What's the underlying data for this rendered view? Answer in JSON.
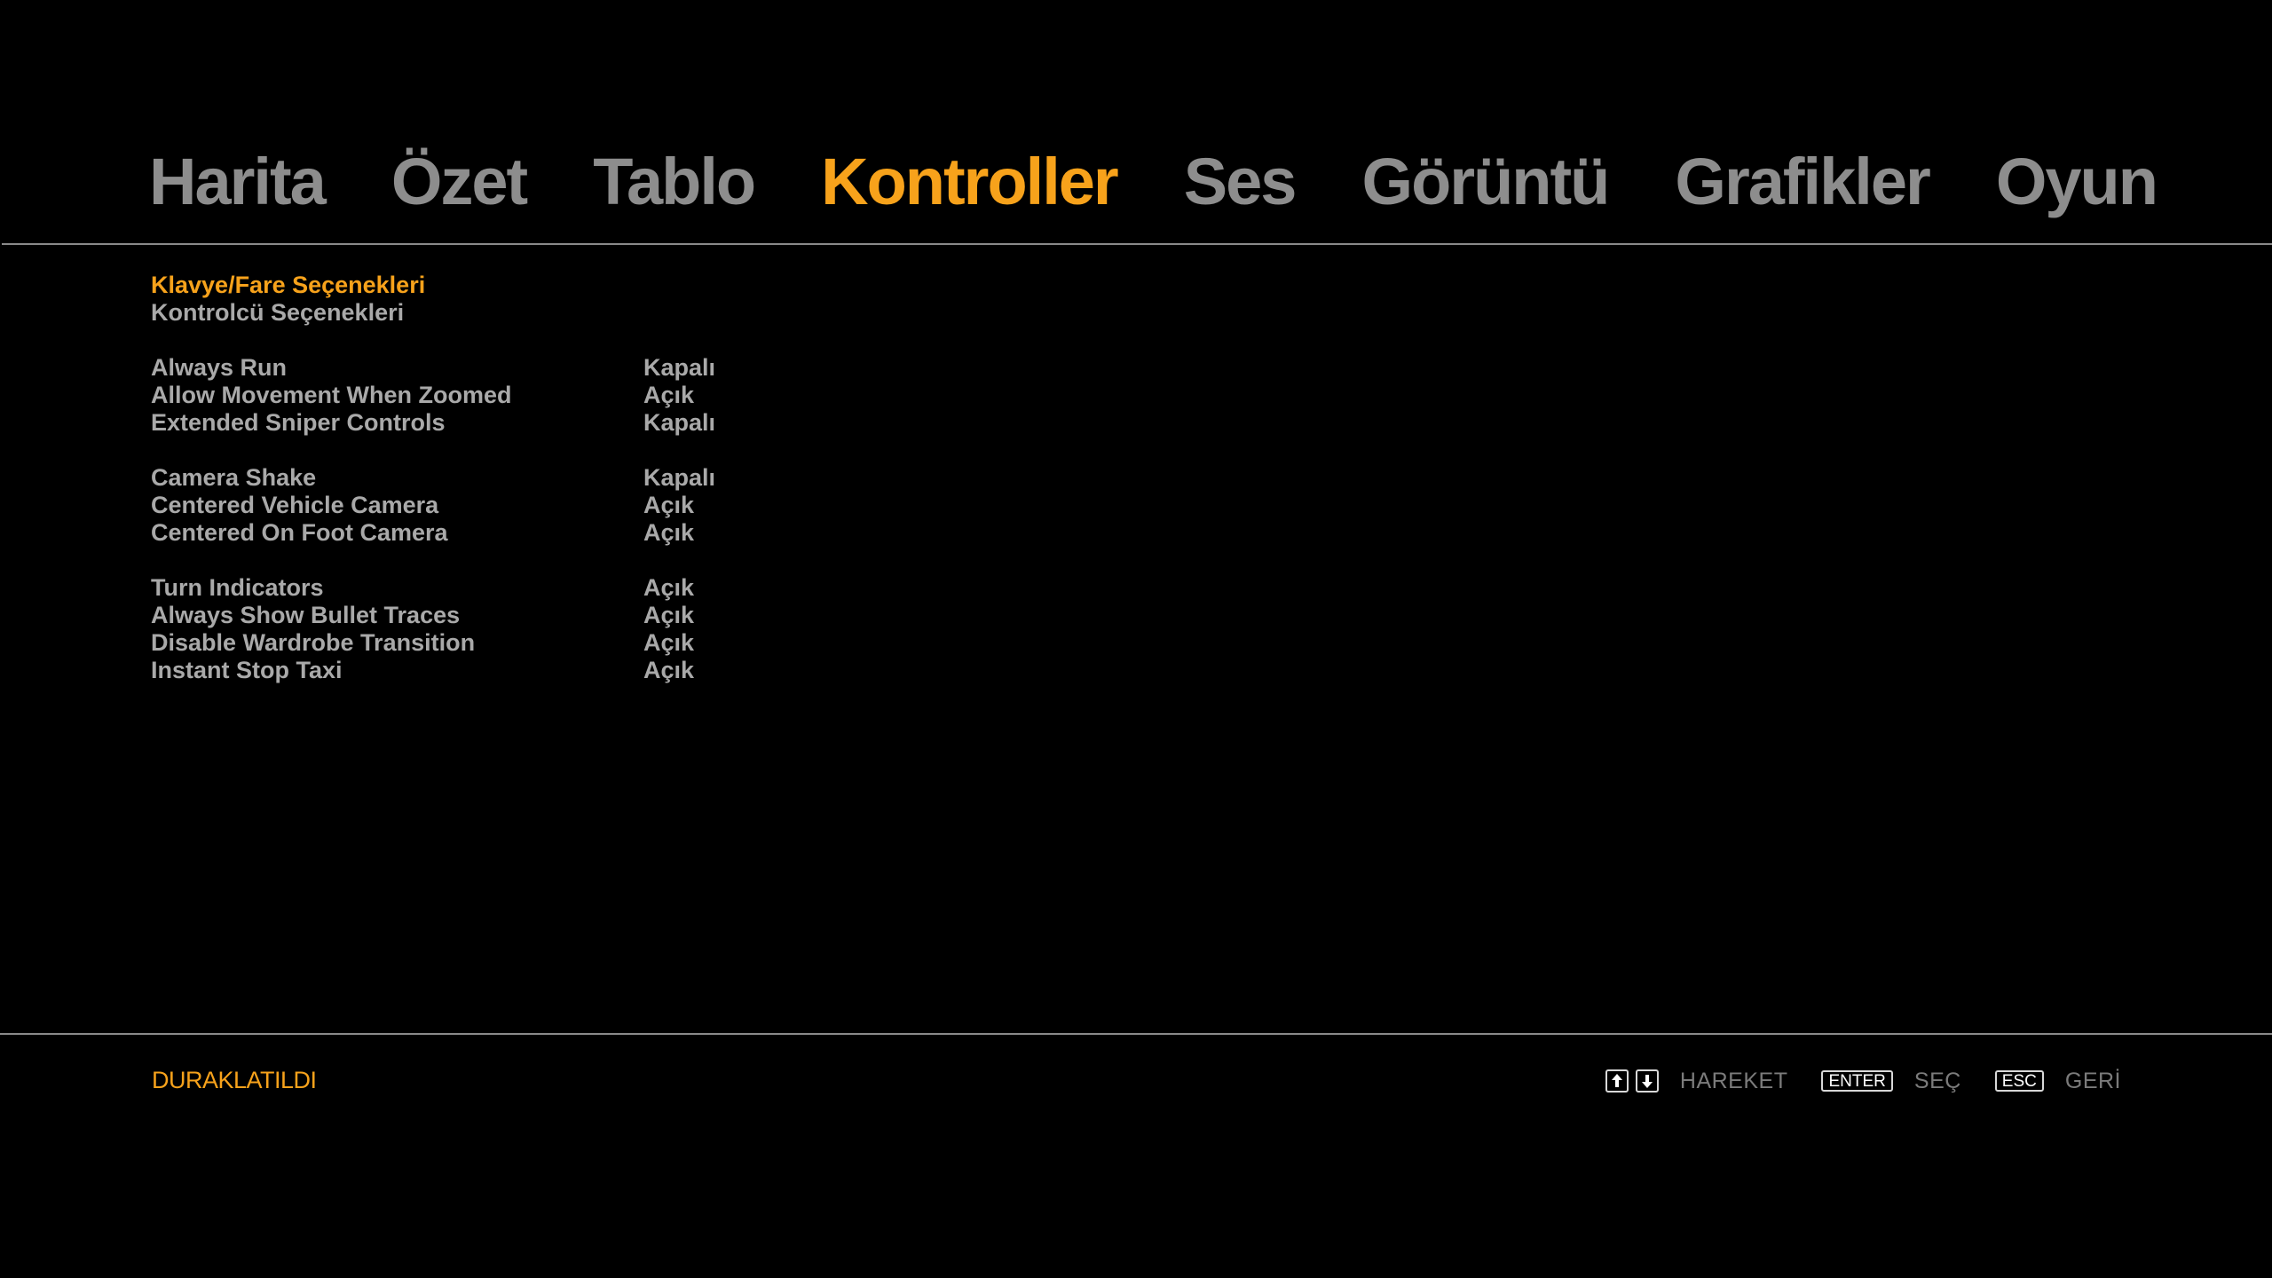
{
  "tabs": [
    {
      "label": "Harita"
    },
    {
      "label": "Özet"
    },
    {
      "label": "Tablo"
    },
    {
      "label": "Kontroller"
    },
    {
      "label": "Ses"
    },
    {
      "label": "Görüntü"
    },
    {
      "label": "Grafikler"
    },
    {
      "label": "Oyun"
    }
  ],
  "active_tab": "Kontroller",
  "submenu": [
    {
      "label": "Klavye/Fare Seçenekleri"
    },
    {
      "label": "Kontrolcü Seçenekleri"
    }
  ],
  "options": {
    "group1": [
      {
        "label": "Always Run",
        "value": "Kapalı"
      },
      {
        "label": "Allow Movement When Zoomed",
        "value": "Açık"
      },
      {
        "label": "Extended Sniper Controls",
        "value": "Kapalı"
      }
    ],
    "group2": [
      {
        "label": "Camera Shake",
        "value": "Kapalı"
      },
      {
        "label": "Centered Vehicle Camera",
        "value": "Açık"
      },
      {
        "label": "Centered On Foot Camera",
        "value": "Açık"
      }
    ],
    "group3": [
      {
        "label": "Turn Indicators",
        "value": "Açık"
      },
      {
        "label": "Always Show Bullet Traces",
        "value": "Açık"
      },
      {
        "label": "Disable Wardrobe Transition",
        "value": "Açık"
      },
      {
        "label": "Instant Stop Taxi",
        "value": "Açık"
      }
    ]
  },
  "footer": {
    "status": "DURAKLATILDI",
    "hints": {
      "move_icons": [
        "arrow-up-icon",
        "arrow-down-icon"
      ],
      "move_label": "HAREKET",
      "select_key": "ENTER",
      "select_label": "SEÇ",
      "back_key": "ESC",
      "back_label": "GERİ"
    }
  },
  "colors": {
    "accent": "#f7a21b",
    "tab_inactive": "#8d8d8d",
    "text": "#a9a9a9",
    "hint_text": "#7b7b7b",
    "rule": "#8a8a8a",
    "background": "#000000"
  }
}
